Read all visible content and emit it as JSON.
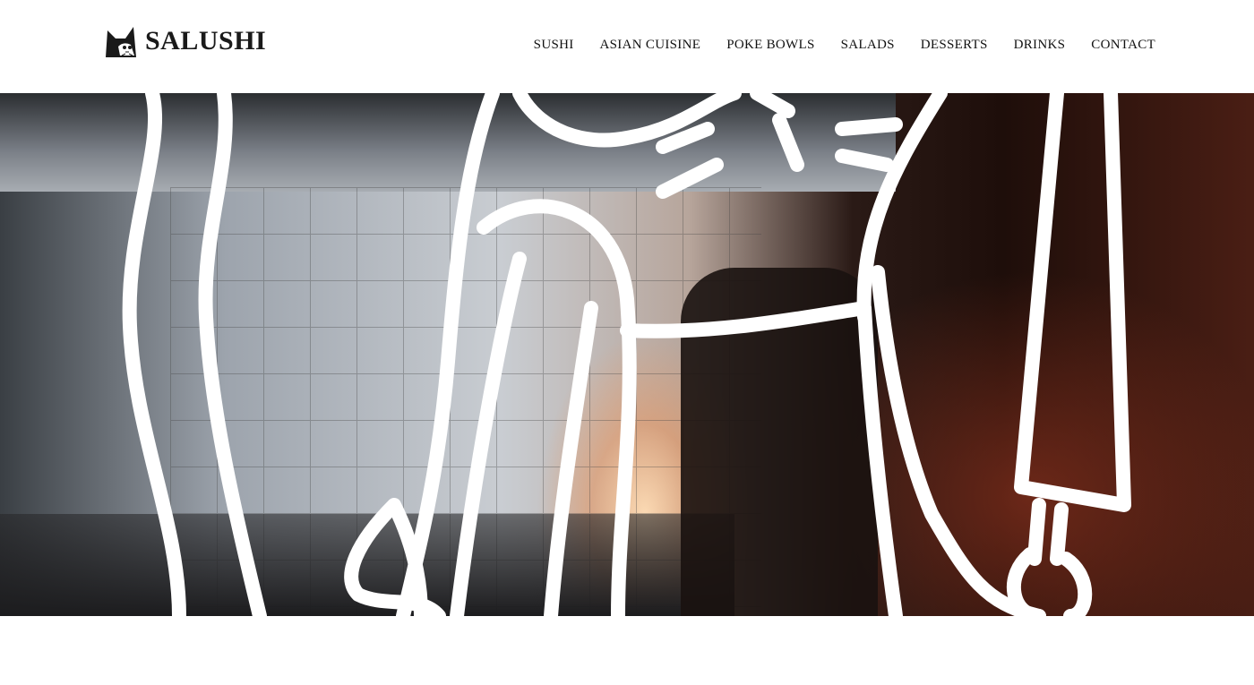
{
  "header": {
    "logo_text": "SALUSHI",
    "nav": [
      {
        "label": "SUSHI"
      },
      {
        "label": "ASIAN CUISINE"
      },
      {
        "label": "POKE BOWLS"
      },
      {
        "label": "SALADS"
      },
      {
        "label": "DESSERTS"
      },
      {
        "label": "DRINKS"
      },
      {
        "label": "CONTACT"
      }
    ]
  },
  "hero": {
    "image": "kitchen-chef-flames-with-white-line-art"
  }
}
